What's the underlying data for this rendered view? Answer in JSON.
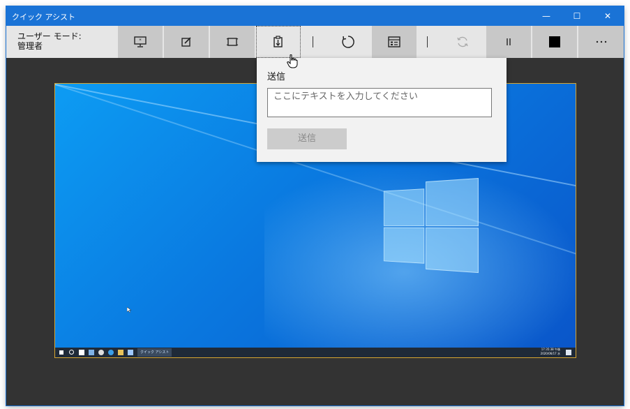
{
  "window": {
    "title": "クイック アシスト"
  },
  "controls": {
    "minimize": "—",
    "maximize": "☐",
    "close": "✕"
  },
  "mode": {
    "line1": "ユーザー モード:",
    "line2": "管理者"
  },
  "toolbar": [
    {
      "name": "select-monitor-icon"
    },
    {
      "name": "annotate-icon"
    },
    {
      "name": "actual-size-icon"
    },
    {
      "name": "instruction-channel-icon"
    },
    {
      "name": "restart-icon"
    },
    {
      "name": "task-manager-icon"
    },
    {
      "name": "reconnect-icon"
    },
    {
      "name": "pause-icon"
    },
    {
      "name": "end-icon"
    },
    {
      "name": "more-icon"
    }
  ],
  "popup": {
    "label": "送信",
    "placeholder": "ここにテキストを入力してください",
    "send_label": "送信"
  },
  "taskbar": {
    "app_label": "クイック アシスト",
    "time": "17:35:38 午後",
    "date": "2020/06/17 水"
  },
  "colors": {
    "accent": "#1a73d6",
    "toolbar": "#e6e6e6",
    "button": "#c8c8c8",
    "background": "#333333",
    "screen_border": "#d6a531"
  }
}
